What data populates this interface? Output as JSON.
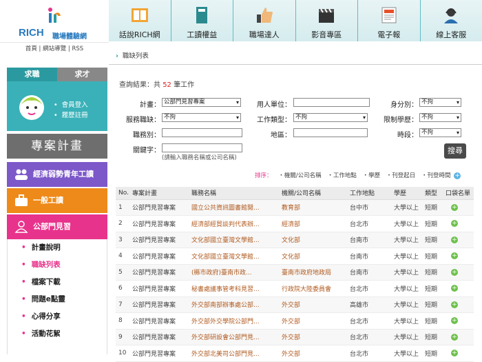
{
  "logo": {
    "brand": "RICH",
    "sub": "職場體驗網"
  },
  "toplinks": [
    "首頁",
    "網站導覽",
    "RSS"
  ],
  "left_tabs": [
    "求職",
    "求才"
  ],
  "member_links": [
    "會員登入",
    "履歷註冊"
  ],
  "project_title": "專案計畫",
  "project_items": [
    "經濟弱勢青年工讀",
    "一般工讀",
    "公部門見習"
  ],
  "submenu": [
    "計畫說明",
    "職缺列表",
    "檔案下載",
    "問題e點靈",
    "心得分享",
    "活動花絮"
  ],
  "nav": [
    "話說RICH網",
    "工讀權益",
    "職場達人",
    "影音專區",
    "電子報",
    "線上客服"
  ],
  "breadcrumb": "職缺列表",
  "result": {
    "prefix": "查詢結果：共",
    "count": "52",
    "suffix": "筆工作"
  },
  "form": {
    "plan_label": "計畫：",
    "plan_value": "公部門見習專案",
    "unit_label": "用人單位：",
    "identity_label": "身分別：",
    "identity_value": "不拘",
    "service_label": "服務職缺：",
    "service_value": "不拘",
    "jobtype_label": "工作類型：",
    "jobtype_value": "不拘",
    "edu_label": "限制學歷：",
    "edu_value": "不拘",
    "duty_label": "職務別：",
    "region_label": "地區：",
    "period_label": "時段：",
    "period_value": "不拘",
    "keyword_label": "關鍵字：",
    "hint": "(請輸入職務名稱或公司名稱)",
    "search_btn": "搜尋"
  },
  "sort": {
    "label": "排序：",
    "items": [
      "機關/公司名稱",
      "工作地點",
      "學歷",
      "刊登起日",
      "刊登時間"
    ]
  },
  "table": {
    "headers": [
      "No.",
      "專案計畫",
      "職務名稱",
      "機關/公司名稱",
      "工作地點",
      "學歷",
      "類型",
      "口袋名單"
    ],
    "rows": [
      [
        "1",
        "公部門見習專案",
        "國立公共資訊圖書館閱...",
        "教育部",
        "台中市",
        "大學以上",
        "短期"
      ],
      [
        "2",
        "公部門見習專案",
        "經濟部經貿談判代表辦...",
        "經濟部",
        "台北市",
        "大學以上",
        "短期"
      ],
      [
        "3",
        "公部門見習專案",
        "文化部國立臺灣文學館...",
        "文化部",
        "台南市",
        "大學以上",
        "短期"
      ],
      [
        "4",
        "公部門見習專案",
        "文化部國立臺灣文學館...",
        "文化部",
        "台南市",
        "大學以上",
        "短期"
      ],
      [
        "5",
        "公部門見習專案",
        "(縣市政府)臺南市政...",
        "臺南市政府地政局",
        "台南市",
        "大學以上",
        "短期"
      ],
      [
        "6",
        "公部門見習專案",
        "秘書處議事管考科見習...",
        "行政院大陸委員會",
        "台北市",
        "大學以上",
        "短期"
      ],
      [
        "7",
        "公部門見習專案",
        "外交部南部辦事處公部...",
        "外交部",
        "高雄市",
        "大學以上",
        "短期"
      ],
      [
        "8",
        "公部門見習專案",
        "外交部外交學院公部門...",
        "外交部",
        "台北市",
        "大學以上",
        "短期"
      ],
      [
        "9",
        "公部門見習專案",
        "外交部研設會公部門見...",
        "外交部",
        "台北市",
        "大學以上",
        "短期"
      ],
      [
        "10",
        "公部門見習專案",
        "外交部北美司公部門見...",
        "外交部",
        "台北市",
        "大學以上",
        "短期"
      ]
    ]
  },
  "colors": {
    "teal": "#2a9ca3",
    "purple": "#7d58c9",
    "orange": "#ee8a1a",
    "pink": "#e8338c"
  }
}
